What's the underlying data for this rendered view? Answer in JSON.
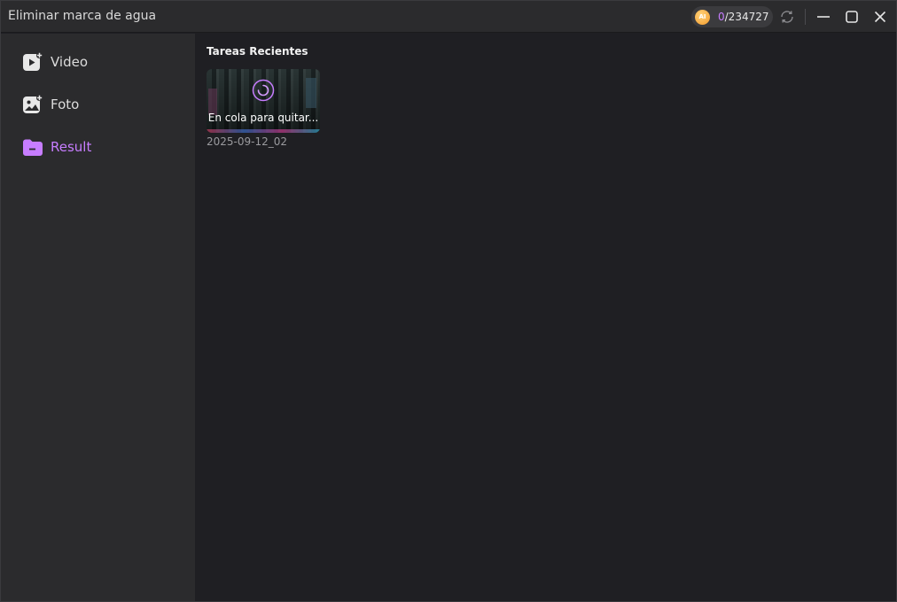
{
  "window": {
    "title": "Eliminar marca de agua"
  },
  "header": {
    "credits_used": "0",
    "credits_total": "/234727",
    "coin_label": "AI"
  },
  "sidebar": {
    "items": [
      {
        "label": "Video",
        "icon": "video-icon"
      },
      {
        "label": "Foto",
        "icon": "photo-icon"
      },
      {
        "label": "Result",
        "icon": "folder-icon",
        "active": true
      }
    ]
  },
  "main": {
    "section_title": "Tareas Recientes",
    "tasks": [
      {
        "status": "En cola para quitar...",
        "date": "2025-09-12_02"
      }
    ]
  },
  "colors": {
    "accent": "#c77dff",
    "sidebar_bg": "#2b2b2d",
    "main_bg": "#1f1f23"
  }
}
